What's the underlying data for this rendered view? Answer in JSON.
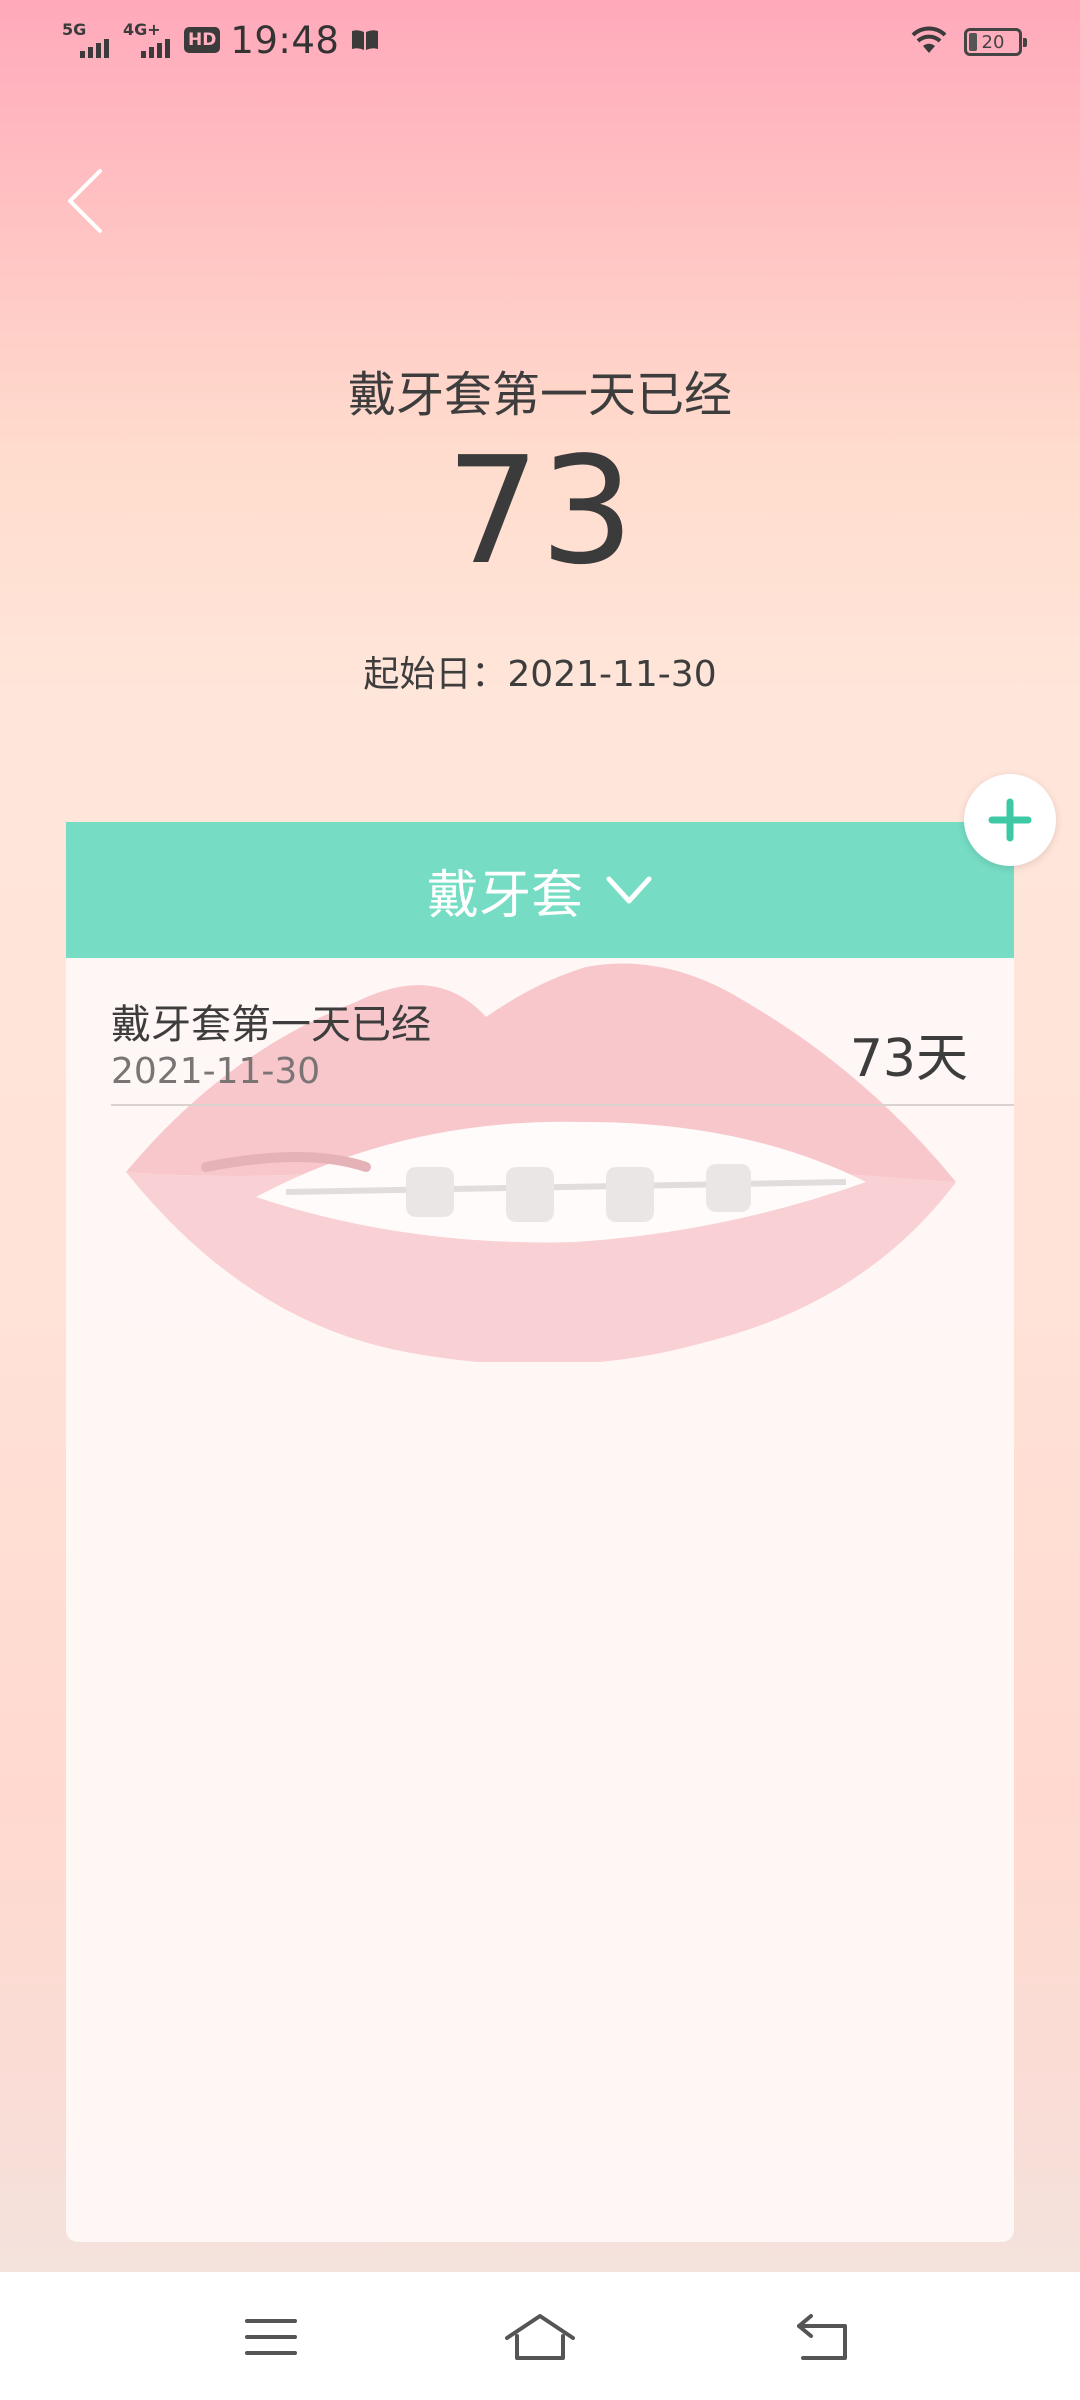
{
  "status_bar": {
    "network1": "5G",
    "network2": "4G+",
    "hd_label": "HD",
    "time": "19:48",
    "battery_level": "20"
  },
  "header": {
    "title": "戴牙套第一天已经",
    "count": "73",
    "start_label": "起始日：2021-11-30"
  },
  "card": {
    "category": "戴牙套",
    "items": [
      {
        "title": "戴牙套第一天已经",
        "date": "2021-11-30",
        "days": "73天"
      }
    ]
  },
  "colors": {
    "accent": "#76dcc4",
    "add_icon": "#3ec9a4",
    "text": "#3d3d3d"
  },
  "icons": {
    "back": "chevron-left-icon",
    "add": "plus-icon",
    "dropdown": "chevron-down-icon",
    "nav_menu": "menu-icon",
    "nav_home": "home-icon",
    "nav_back": "back-arrow-icon"
  }
}
